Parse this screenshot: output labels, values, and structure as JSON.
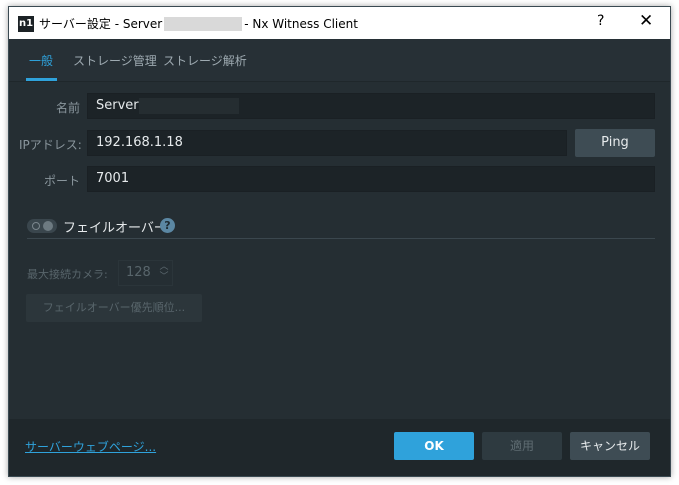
{
  "window": {
    "title_prefix": "サーバー設定 - Server",
    "title_suffix": "- Nx Witness Client",
    "app_icon": "n1",
    "help_glyph": "?",
    "close_glyph": "✕"
  },
  "tabs": [
    {
      "label": "一般",
      "active": true
    },
    {
      "label": "ストレージ管理",
      "active": false
    },
    {
      "label": "ストレージ解析",
      "active": false
    }
  ],
  "general": {
    "name_label": "名前",
    "name_value": "Server",
    "ip_label": "IPアドレス:",
    "ip_value": "192.168.1.18",
    "ping_label": "Ping",
    "port_label": "ポート",
    "port_value": "7001",
    "failover_label": "フェイルオーバー",
    "failover_enabled": false,
    "help_glyph": "?",
    "max_cameras_label": "最大接続カメラ:",
    "max_cameras_value": "128",
    "priority_button_label": "フェイルオーバー優先順位..."
  },
  "footer": {
    "web_page_link": "サーバーウェブページ...",
    "ok_label": "OK",
    "apply_label": "適用",
    "cancel_label": "キャンセル"
  },
  "colors": {
    "accent": "#2fa2db",
    "background": "#252e33"
  }
}
